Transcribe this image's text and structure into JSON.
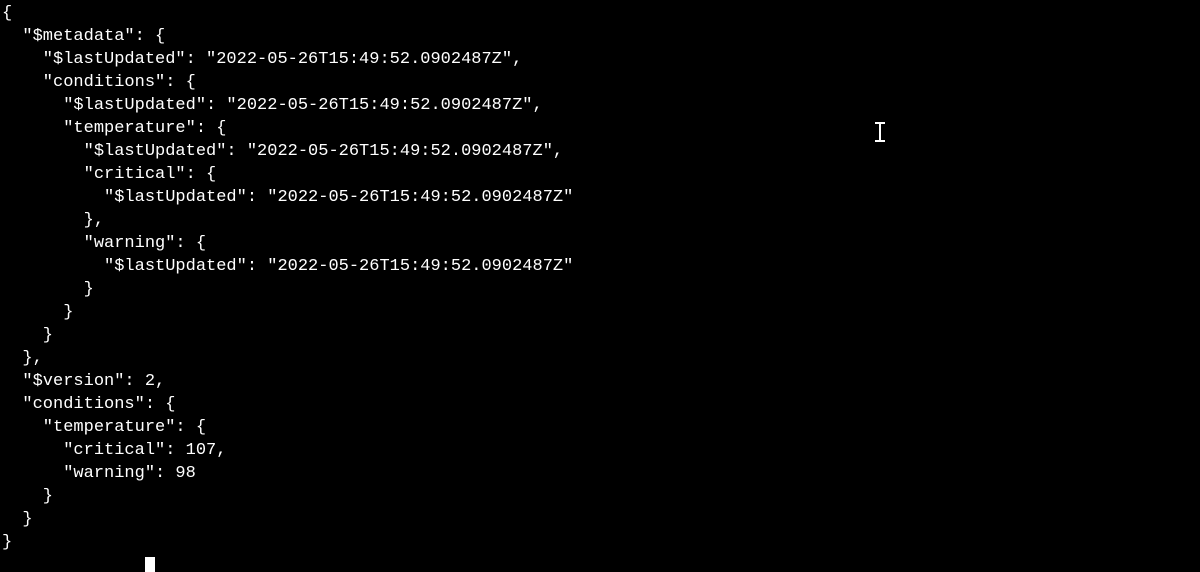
{
  "lines": {
    "l0": "{",
    "l1": "  \"$metadata\": {",
    "l2": "    \"$lastUpdated\": \"2022-05-26T15:49:52.0902487Z\",",
    "l3": "    \"conditions\": {",
    "l4": "      \"$lastUpdated\": \"2022-05-26T15:49:52.0902487Z\",",
    "l5": "      \"temperature\": {",
    "l6": "        \"$lastUpdated\": \"2022-05-26T15:49:52.0902487Z\",",
    "l7": "        \"critical\": {",
    "l8": "          \"$lastUpdated\": \"2022-05-26T15:49:52.0902487Z\"",
    "l9": "        },",
    "l10": "        \"warning\": {",
    "l11": "          \"$lastUpdated\": \"2022-05-26T15:49:52.0902487Z\"",
    "l12": "        }",
    "l13": "      }",
    "l14": "    }",
    "l15": "  },",
    "l16": "  \"$version\": 2,",
    "l17": "  \"conditions\": {",
    "l18": "    \"temperature\": {",
    "l19": "      \"critical\": 107,",
    "l20": "      \"warning\": 98",
    "l21": "    }",
    "l22": "  }",
    "l23": "}"
  }
}
